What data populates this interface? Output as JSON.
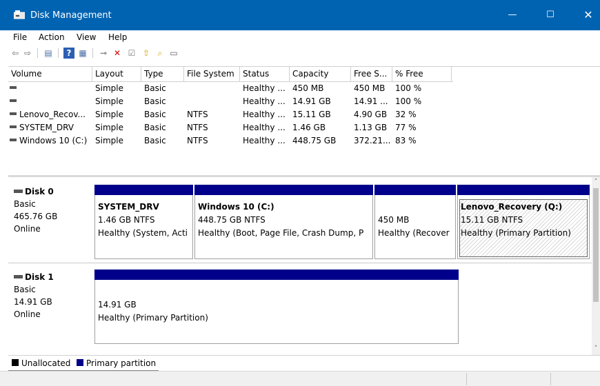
{
  "window": {
    "title": "Disk Management",
    "minimize": "—",
    "maximize": "☐",
    "close": "✕"
  },
  "menu": [
    "File",
    "Action",
    "View",
    "Help"
  ],
  "toolbar": {
    "back": "⇦",
    "forward": "⇨",
    "properties": "▤",
    "help": "?",
    "console": "▦",
    "connect": "⊸",
    "delete": "✕",
    "check": "☑",
    "up": "⇧",
    "search": "⌕",
    "format": "▭"
  },
  "volume_list": {
    "columns": [
      "Volume",
      "Layout",
      "Type",
      "File System",
      "Status",
      "Capacity",
      "Free S...",
      "% Free"
    ],
    "rows": [
      {
        "volume": "",
        "layout": "Simple",
        "type": "Basic",
        "fs": "",
        "status": "Healthy ...",
        "capacity": "450 MB",
        "free": "450 MB",
        "pct": "100 %"
      },
      {
        "volume": "",
        "layout": "Simple",
        "type": "Basic",
        "fs": "",
        "status": "Healthy ...",
        "capacity": "14.91 GB",
        "free": "14.91 ...",
        "pct": "100 %"
      },
      {
        "volume": "Lenovo_Recov...",
        "layout": "Simple",
        "type": "Basic",
        "fs": "NTFS",
        "status": "Healthy ...",
        "capacity": "15.11 GB",
        "free": "4.90 GB",
        "pct": "32 %"
      },
      {
        "volume": "SYSTEM_DRV",
        "layout": "Simple",
        "type": "Basic",
        "fs": "NTFS",
        "status": "Healthy ...",
        "capacity": "1.46 GB",
        "free": "1.13 GB",
        "pct": "77 %"
      },
      {
        "volume": "Windows 10 (C:)",
        "layout": "Simple",
        "type": "Basic",
        "fs": "NTFS",
        "status": "Healthy ...",
        "capacity": "448.75 GB",
        "free": "372.21...",
        "pct": "83 %"
      }
    ]
  },
  "disks": [
    {
      "name": "Disk 0",
      "type": "Basic",
      "size": "465.76 GB",
      "state": "Online",
      "partitions": [
        {
          "name": "SYSTEM_DRV",
          "size": "1.46 GB NTFS",
          "status": "Healthy (System, Acti"
        },
        {
          "name": "Windows 10  (C:)",
          "size": "448.75 GB NTFS",
          "status": "Healthy (Boot, Page File, Crash Dump, P"
        },
        {
          "name": "",
          "size": "450 MB",
          "status": "Healthy (Recover"
        },
        {
          "name": "Lenovo_Recovery  (Q:)",
          "size": "15.11 GB NTFS",
          "status": "Healthy (Primary Partition)"
        }
      ]
    },
    {
      "name": "Disk 1",
      "type": "Basic",
      "size": "14.91 GB",
      "state": "Online",
      "partitions": [
        {
          "name": "",
          "size": "14.91 GB",
          "status": "Healthy (Primary Partition)"
        }
      ]
    }
  ],
  "legend": [
    {
      "label": "Unallocated",
      "color": "#000000"
    },
    {
      "label": "Primary partition",
      "color": "#00008b"
    }
  ],
  "scroll": {
    "up": "˄",
    "down": "˅"
  }
}
